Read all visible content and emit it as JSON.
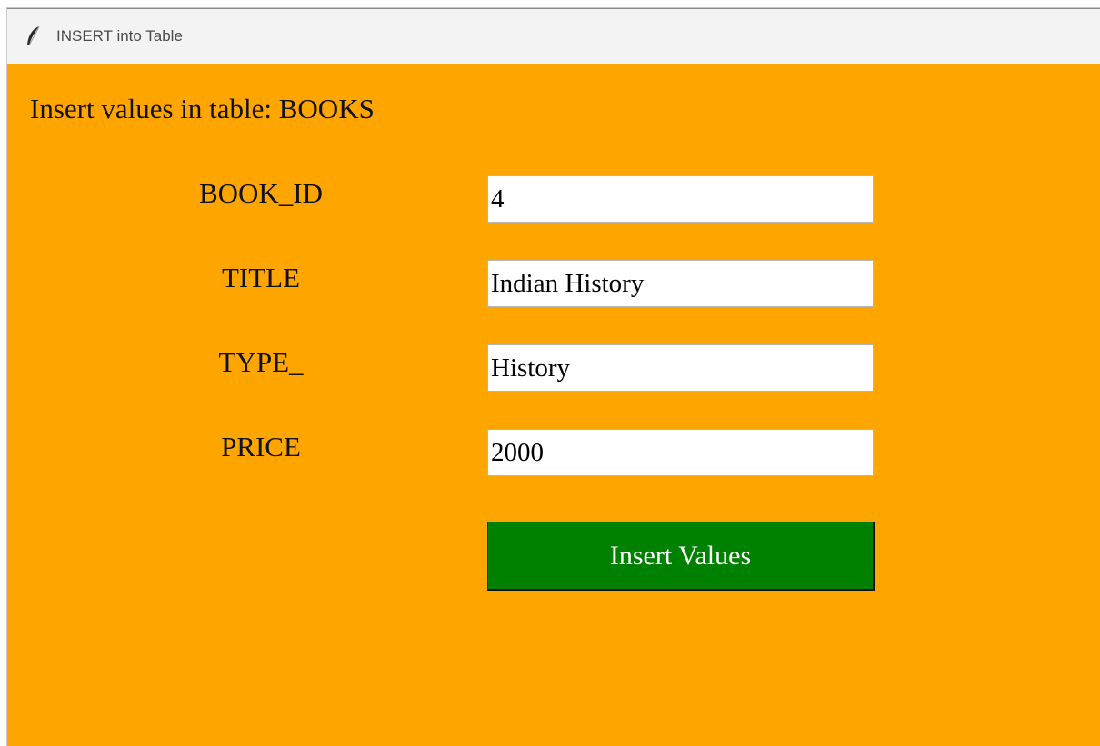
{
  "window": {
    "title": "INSERT into Table",
    "icon": "feather-icon"
  },
  "form": {
    "heading": "Insert values in table: BOOKS",
    "fields": [
      {
        "label": "BOOK_ID",
        "value": "4"
      },
      {
        "label": "TITLE",
        "value": "Indian History"
      },
      {
        "label": "TYPE_",
        "value": "History"
      },
      {
        "label": "PRICE",
        "value": "2000"
      }
    ],
    "submit_label": "Insert Values"
  },
  "colors": {
    "background": "#ffa500",
    "button": "#008000",
    "button_text": "#ffffff",
    "titlebar": "#f3f3f3"
  }
}
